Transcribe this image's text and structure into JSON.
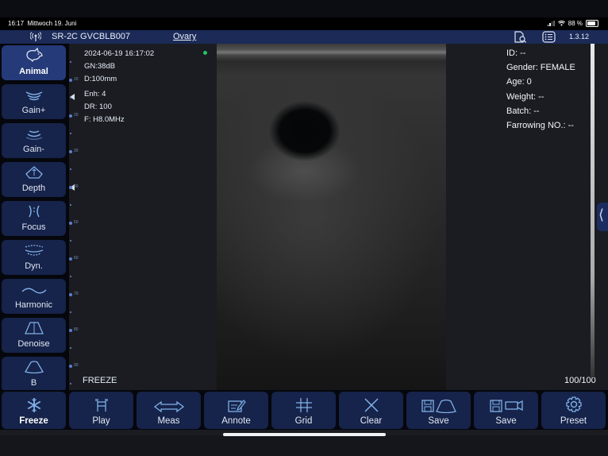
{
  "status_bar": {
    "time": "16:17",
    "date": "Mittwoch 19. Juni",
    "battery": "88 %"
  },
  "header": {
    "probe": "SR-2C GVCBLB007",
    "preset": "Ovary",
    "version": "1.3.12"
  },
  "sidebar": {
    "items": [
      {
        "label": "Animal",
        "icon": "pig-icon"
      },
      {
        "label": "Gain+",
        "icon": "gain-up-icon"
      },
      {
        "label": "Gain-",
        "icon": "gain-down-icon"
      },
      {
        "label": "Depth",
        "icon": "depth-icon"
      },
      {
        "label": "Focus",
        "icon": "focus-icon"
      },
      {
        "label": "Dyn.",
        "icon": "dynamic-range-icon"
      },
      {
        "label": "Harmonic",
        "icon": "harmonic-wave-icon"
      },
      {
        "label": "Denoise",
        "icon": "denoise-icon"
      },
      {
        "label": "B",
        "icon": "b-mode-icon"
      }
    ]
  },
  "depth_scale": {
    "ticks": [
      "10",
      "20",
      "30",
      "40",
      "50",
      "60",
      "70",
      "80",
      "90"
    ]
  },
  "image_info": {
    "datetime": "2024-06-19 16:17:02",
    "gain": "GN:38dB",
    "depth": "D:100mm",
    "enhancement": "Enh: 4",
    "dynamic_range": "DR: 100",
    "frequency": "F: H8.0MHz",
    "mode_status": "FREEZE",
    "frame_counter": "100/100"
  },
  "patient": {
    "id": "ID: --",
    "gender": "Gender: FEMALE",
    "age": "Age: 0",
    "weight": "Weight: --",
    "batch": "Batch: --",
    "farrowing": "Farrowing NO.: --"
  },
  "toolbar": {
    "items": [
      {
        "label": "Freeze",
        "icon": "snowflake-icon"
      },
      {
        "label": "Play",
        "icon": "play-cine-icon"
      },
      {
        "label": "Meas",
        "icon": "measure-arrow-icon"
      },
      {
        "label": "Annote",
        "icon": "annotate-icon"
      },
      {
        "label": "Grid",
        "icon": "grid-icon"
      },
      {
        "label": "Clear",
        "icon": "clear-x-icon"
      },
      {
        "label": "Save",
        "icon": "save-image-icon"
      },
      {
        "label": "Save",
        "icon": "save-cine-icon"
      },
      {
        "label": "Preset",
        "icon": "gear-icon"
      }
    ]
  },
  "colors": {
    "button_bg": "#16234a",
    "header_bg": "#1b2a57",
    "accent_green": "#22c55e",
    "scale_blue": "#5b82d2"
  }
}
